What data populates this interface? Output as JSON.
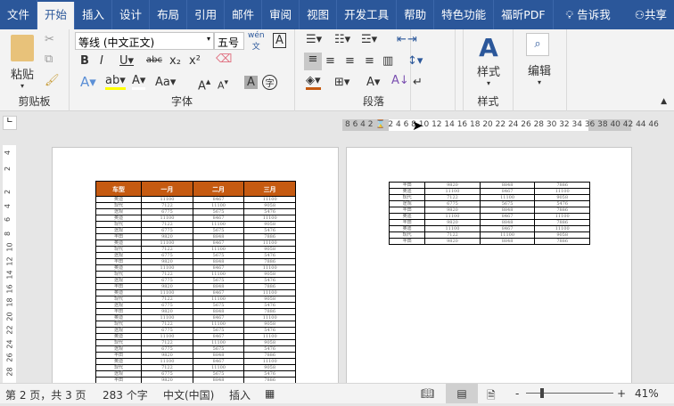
{
  "tabs": [
    "文件",
    "开始",
    "插入",
    "设计",
    "布局",
    "引用",
    "邮件",
    "审阅",
    "视图",
    "开发工具",
    "帮助",
    "特色功能",
    "福昕PDF",
    "告诉我",
    "共享"
  ],
  "ribbon": {
    "paste": "粘贴",
    "clipboard": "剪贴板",
    "font_name": "等线 (中文正文)",
    "font_size": "五号",
    "font": "字体",
    "paragraph": "段落",
    "styles_btn": "样式",
    "styles": "样式",
    "edit": "编辑"
  },
  "ruler": {
    "marks": "8  6  4  2  ⌛ 2  4  6  8 10 12 14 16 18 20 22 24 26 28 30 32 34 36 38 40 42 44 46",
    "vmarks": [
      "4",
      "2",
      "2",
      "4",
      "6",
      "8",
      "10",
      "12",
      "14",
      "16",
      "18",
      "20",
      "22",
      "24",
      "26",
      "28"
    ]
  },
  "table": {
    "headers": [
      "车型",
      "一月",
      "二月",
      "三月"
    ],
    "left_rows": [
      [
        "奥迪",
        "11100",
        "8467",
        "11100"
      ],
      [
        "现代",
        "7122",
        "11100",
        "9058"
      ],
      [
        "途观",
        "6775",
        "5675",
        "5476"
      ],
      [
        "奥迪",
        "11100",
        "8467",
        "11100"
      ],
      [
        "现代",
        "7122",
        "11100",
        "9058"
      ],
      [
        "途观",
        "6775",
        "5675",
        "5476"
      ],
      [
        "丰田",
        "9820",
        "8848",
        "7886"
      ],
      [
        "奥迪",
        "11100",
        "8467",
        "11100"
      ],
      [
        "现代",
        "7122",
        "11100",
        "9058"
      ],
      [
        "途观",
        "6775",
        "5675",
        "5476"
      ],
      [
        "丰田",
        "9820",
        "8848",
        "7886"
      ],
      [
        "奥迪",
        "11100",
        "8467",
        "11100"
      ],
      [
        "现代",
        "7122",
        "11100",
        "9058"
      ],
      [
        "途观",
        "6775",
        "5675",
        "5476"
      ],
      [
        "丰田",
        "9820",
        "8848",
        "7886"
      ],
      [
        "奥迪",
        "11100",
        "8467",
        "11100"
      ],
      [
        "现代",
        "7122",
        "11100",
        "9058"
      ],
      [
        "途观",
        "6775",
        "5675",
        "5476"
      ],
      [
        "丰田",
        "9820",
        "8848",
        "7886"
      ],
      [
        "奥迪",
        "11100",
        "8467",
        "11100"
      ],
      [
        "现代",
        "7122",
        "11100",
        "9058"
      ],
      [
        "途观",
        "6775",
        "5675",
        "5476"
      ],
      [
        "奥迪",
        "11100",
        "8467",
        "11100"
      ],
      [
        "现代",
        "7122",
        "11100",
        "9058"
      ],
      [
        "途观",
        "6775",
        "5675",
        "5476"
      ],
      [
        "丰田",
        "9820",
        "8848",
        "7886"
      ],
      [
        "奥迪",
        "11100",
        "8467",
        "11100"
      ],
      [
        "现代",
        "7122",
        "11100",
        "9058"
      ],
      [
        "途观",
        "6775",
        "5675",
        "5476"
      ],
      [
        "丰田",
        "9820",
        "8848",
        "7886"
      ]
    ],
    "right_rows": [
      [
        "丰田",
        "9820",
        "8848",
        "7886"
      ],
      [
        "奥迪",
        "11100",
        "8467",
        "11100"
      ],
      [
        "现代",
        "7122",
        "11100",
        "9058"
      ],
      [
        "途观",
        "6775",
        "5675",
        "5476"
      ],
      [
        "丰田",
        "9820",
        "8848",
        "7886"
      ],
      [
        "奥迪",
        "11100",
        "8467",
        "11100"
      ],
      [
        "丰田",
        "9820",
        "8848",
        "7886"
      ],
      [
        "奥迪",
        "11100",
        "8467",
        "11100"
      ],
      [
        "现代",
        "7122",
        "11100",
        "9058"
      ],
      [
        "丰田",
        "9820",
        "8848",
        "7886"
      ]
    ]
  },
  "status": {
    "page": "第 2 页，共 3 页",
    "words": "283 个字",
    "lang": "中文(中国)",
    "mode": "插入",
    "zoom": "41%"
  },
  "colors": {
    "brand": "#2b579a",
    "header": "#c55a11"
  }
}
